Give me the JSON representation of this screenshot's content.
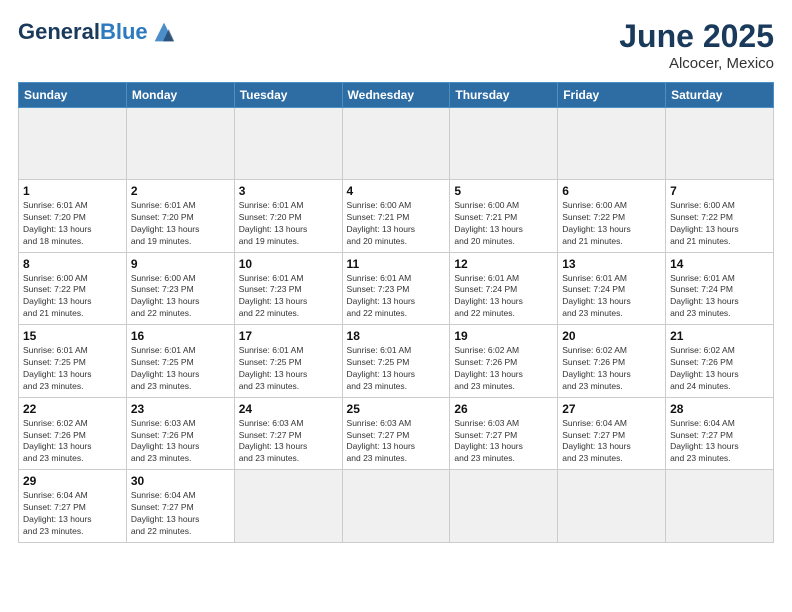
{
  "header": {
    "logo_line1": "General",
    "logo_line2": "Blue",
    "month": "June 2025",
    "location": "Alcocer, Mexico"
  },
  "weekdays": [
    "Sunday",
    "Monday",
    "Tuesday",
    "Wednesday",
    "Thursday",
    "Friday",
    "Saturday"
  ],
  "days": [
    {
      "num": "",
      "info": ""
    },
    {
      "num": "",
      "info": ""
    },
    {
      "num": "",
      "info": ""
    },
    {
      "num": "",
      "info": ""
    },
    {
      "num": "",
      "info": ""
    },
    {
      "num": "",
      "info": ""
    },
    {
      "num": "",
      "info": ""
    },
    {
      "num": "1",
      "info": "Sunrise: 6:01 AM\nSunset: 7:20 PM\nDaylight: 13 hours\nand 18 minutes."
    },
    {
      "num": "2",
      "info": "Sunrise: 6:01 AM\nSunset: 7:20 PM\nDaylight: 13 hours\nand 19 minutes."
    },
    {
      "num": "3",
      "info": "Sunrise: 6:01 AM\nSunset: 7:20 PM\nDaylight: 13 hours\nand 19 minutes."
    },
    {
      "num": "4",
      "info": "Sunrise: 6:00 AM\nSunset: 7:21 PM\nDaylight: 13 hours\nand 20 minutes."
    },
    {
      "num": "5",
      "info": "Sunrise: 6:00 AM\nSunset: 7:21 PM\nDaylight: 13 hours\nand 20 minutes."
    },
    {
      "num": "6",
      "info": "Sunrise: 6:00 AM\nSunset: 7:22 PM\nDaylight: 13 hours\nand 21 minutes."
    },
    {
      "num": "7",
      "info": "Sunrise: 6:00 AM\nSunset: 7:22 PM\nDaylight: 13 hours\nand 21 minutes."
    },
    {
      "num": "8",
      "info": "Sunrise: 6:00 AM\nSunset: 7:22 PM\nDaylight: 13 hours\nand 21 minutes."
    },
    {
      "num": "9",
      "info": "Sunrise: 6:00 AM\nSunset: 7:23 PM\nDaylight: 13 hours\nand 22 minutes."
    },
    {
      "num": "10",
      "info": "Sunrise: 6:01 AM\nSunset: 7:23 PM\nDaylight: 13 hours\nand 22 minutes."
    },
    {
      "num": "11",
      "info": "Sunrise: 6:01 AM\nSunset: 7:23 PM\nDaylight: 13 hours\nand 22 minutes."
    },
    {
      "num": "12",
      "info": "Sunrise: 6:01 AM\nSunset: 7:24 PM\nDaylight: 13 hours\nand 22 minutes."
    },
    {
      "num": "13",
      "info": "Sunrise: 6:01 AM\nSunset: 7:24 PM\nDaylight: 13 hours\nand 23 minutes."
    },
    {
      "num": "14",
      "info": "Sunrise: 6:01 AM\nSunset: 7:24 PM\nDaylight: 13 hours\nand 23 minutes."
    },
    {
      "num": "15",
      "info": "Sunrise: 6:01 AM\nSunset: 7:25 PM\nDaylight: 13 hours\nand 23 minutes."
    },
    {
      "num": "16",
      "info": "Sunrise: 6:01 AM\nSunset: 7:25 PM\nDaylight: 13 hours\nand 23 minutes."
    },
    {
      "num": "17",
      "info": "Sunrise: 6:01 AM\nSunset: 7:25 PM\nDaylight: 13 hours\nand 23 minutes."
    },
    {
      "num": "18",
      "info": "Sunrise: 6:01 AM\nSunset: 7:25 PM\nDaylight: 13 hours\nand 23 minutes."
    },
    {
      "num": "19",
      "info": "Sunrise: 6:02 AM\nSunset: 7:26 PM\nDaylight: 13 hours\nand 23 minutes."
    },
    {
      "num": "20",
      "info": "Sunrise: 6:02 AM\nSunset: 7:26 PM\nDaylight: 13 hours\nand 23 minutes."
    },
    {
      "num": "21",
      "info": "Sunrise: 6:02 AM\nSunset: 7:26 PM\nDaylight: 13 hours\nand 24 minutes."
    },
    {
      "num": "22",
      "info": "Sunrise: 6:02 AM\nSunset: 7:26 PM\nDaylight: 13 hours\nand 23 minutes."
    },
    {
      "num": "23",
      "info": "Sunrise: 6:03 AM\nSunset: 7:26 PM\nDaylight: 13 hours\nand 23 minutes."
    },
    {
      "num": "24",
      "info": "Sunrise: 6:03 AM\nSunset: 7:27 PM\nDaylight: 13 hours\nand 23 minutes."
    },
    {
      "num": "25",
      "info": "Sunrise: 6:03 AM\nSunset: 7:27 PM\nDaylight: 13 hours\nand 23 minutes."
    },
    {
      "num": "26",
      "info": "Sunrise: 6:03 AM\nSunset: 7:27 PM\nDaylight: 13 hours\nand 23 minutes."
    },
    {
      "num": "27",
      "info": "Sunrise: 6:04 AM\nSunset: 7:27 PM\nDaylight: 13 hours\nand 23 minutes."
    },
    {
      "num": "28",
      "info": "Sunrise: 6:04 AM\nSunset: 7:27 PM\nDaylight: 13 hours\nand 23 minutes."
    },
    {
      "num": "29",
      "info": "Sunrise: 6:04 AM\nSunset: 7:27 PM\nDaylight: 13 hours\nand 23 minutes."
    },
    {
      "num": "30",
      "info": "Sunrise: 6:04 AM\nSunset: 7:27 PM\nDaylight: 13 hours\nand 22 minutes."
    },
    {
      "num": "",
      "info": ""
    },
    {
      "num": "",
      "info": ""
    },
    {
      "num": "",
      "info": ""
    },
    {
      "num": "",
      "info": ""
    },
    {
      "num": "",
      "info": ""
    }
  ]
}
